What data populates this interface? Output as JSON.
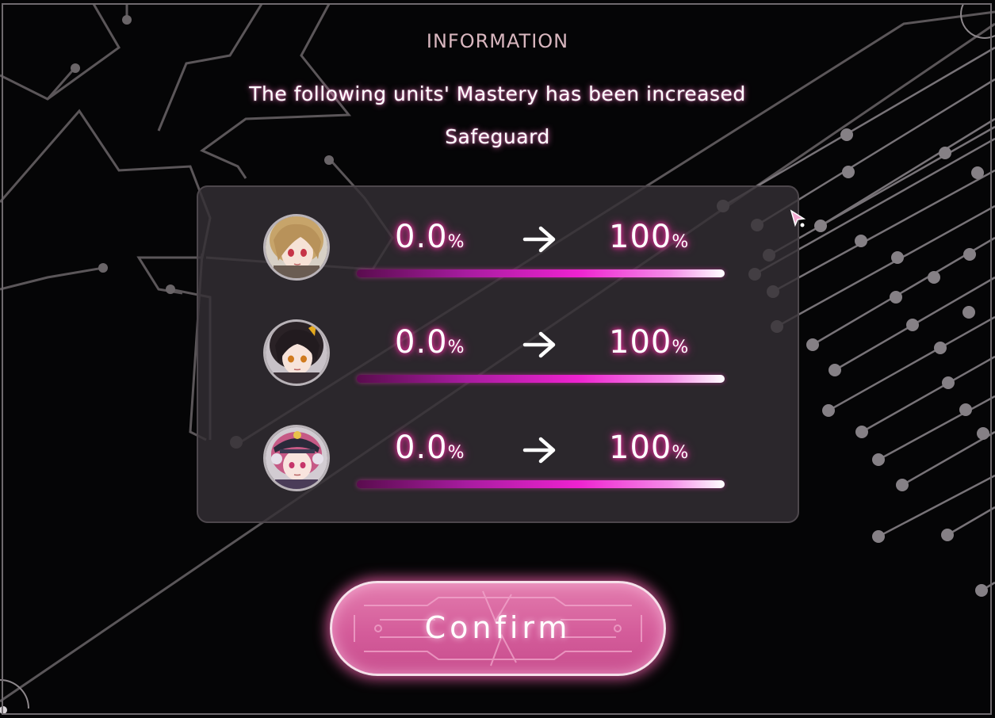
{
  "dialog": {
    "title": "INFORMATION",
    "message": "The following units' Mastery has been increased",
    "unit_name": "Safeguard"
  },
  "units": [
    {
      "before_value": "0.0",
      "before_unit": "%",
      "after_value": "100",
      "after_unit": "%",
      "progress": 1.0,
      "portrait": "blonde-hair-girl-portrait"
    },
    {
      "before_value": "0.0",
      "before_unit": "%",
      "after_value": "100",
      "after_unit": "%",
      "progress": 1.0,
      "portrait": "dark-hair-girl-portrait"
    },
    {
      "before_value": "0.0",
      "before_unit": "%",
      "after_value": "100",
      "after_unit": "%",
      "progress": 1.0,
      "portrait": "pink-hair-cap-girl-portrait"
    }
  ],
  "confirm_button": {
    "label": "Confirm"
  },
  "colors": {
    "accent_pink": "#ff2fa8",
    "button_pink": "#d45c9a",
    "panel": "#343034",
    "title_text": "#d9b7bf"
  },
  "icons": {
    "arrow": "arrow-right-icon",
    "cursor": "pointer-cursor-icon"
  }
}
